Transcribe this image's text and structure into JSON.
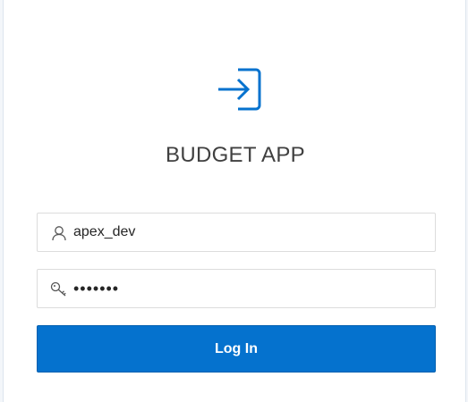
{
  "app": {
    "title": "BUDGET APP",
    "logo_icon": "sign-in-icon",
    "accent_color": "#0572ce"
  },
  "login": {
    "username": {
      "value": "apex_dev",
      "icon": "user-icon"
    },
    "password": {
      "value": "•••••••",
      "icon": "key-icon"
    },
    "submit_label": "Log In"
  }
}
